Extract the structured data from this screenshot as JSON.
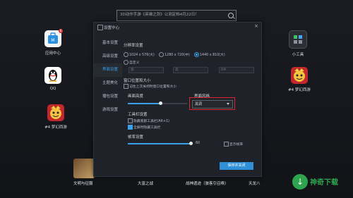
{
  "search": {
    "text": "3D动作手游《英雄之剑》公测定档4月22日！"
  },
  "desktop": {
    "icons": [
      {
        "label": "应用中心",
        "badge": "6"
      },
      {
        "label": "QQ"
      },
      {
        "label": "#4 梦幻西游"
      },
      {
        "label": "小工具"
      },
      {
        "label": "#4 梦幻西游"
      }
    ]
  },
  "window": {
    "title": "设置中心",
    "close": "×",
    "sidebar": [
      "基本设置",
      "高级设置",
      "界面设置",
      "主题美化",
      "播包设置",
      "游戏设置"
    ],
    "sidebar_active": 2,
    "resolution": {
      "header": "分辨率设置",
      "options": [
        "1024 x 576(大)",
        "1280 x 720(中)",
        "1440 x 810(大)",
        "自定义"
      ],
      "selected": 2,
      "width_placeholder": "宽",
      "height_placeholder": "高",
      "dpi_placeholder": "DPI"
    },
    "window_size": {
      "header": "窗口位置和大小",
      "option": "记住上次关闭时窗口位置和大小",
      "checked": false
    },
    "brightness": {
      "header": "画面亮度",
      "value": 0.55
    },
    "style": {
      "header": "界面风格",
      "value": "黑调"
    },
    "toolbar": {
      "header": "工具栏设置",
      "options": [
        "隐藏底部工具栏(Alt+1)",
        "全屏时隐藏工具栏"
      ],
      "checked": [
        false,
        true
      ]
    },
    "fps": {
      "header": "帧率设置",
      "value": 60,
      "max_label": "60",
      "show_fps": "显示帧率",
      "show_fps_checked": false
    },
    "save_button": "保存并关闭"
  },
  "bottom": {
    "games": [
      "文明与征服",
      "大富之战",
      "战神遗迹（骇客引召唤）",
      "天龙八"
    ]
  },
  "logo": {
    "name": "神奇下载"
  },
  "colors": {
    "accent": "#3aa0e8",
    "highlight": "#e0242c",
    "logo": "#2ea44f"
  }
}
